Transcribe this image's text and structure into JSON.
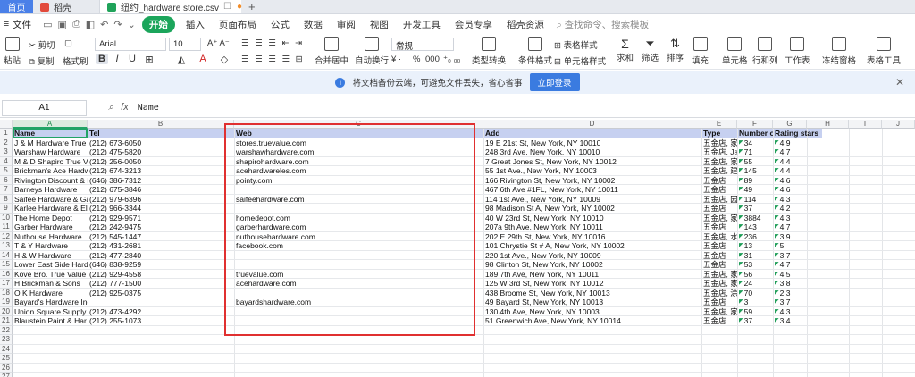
{
  "tabs": {
    "home": "首页",
    "shell": "稻壳",
    "doc": "纽约_hardware store.csv",
    "add": "+"
  },
  "menu": {
    "file": "文件",
    "items": [
      "开始",
      "插入",
      "页面布局",
      "公式",
      "数据",
      "审阅",
      "视图",
      "开发工具",
      "会员专享",
      "稻壳资源"
    ],
    "search": "查找命令、搜索模板"
  },
  "ribbon": {
    "paste": "粘贴",
    "cut": "剪切",
    "copy": "复制",
    "format_painter": "格式刷",
    "font": "Arial",
    "size": "10",
    "merge": "合并居中",
    "wrap": "自动换行",
    "numfmt": "常规",
    "type_convert": "类型转换",
    "cond_format": "条件格式",
    "table_style": "表格样式",
    "cell_style": "单元格样式",
    "sum": "求和",
    "filter": "筛选",
    "sort": "排序",
    "fill": "填充",
    "cell": "单元格",
    "rowcol": "行和列",
    "sheet": "工作表",
    "freeze": "冻结窗格",
    "table_tools": "表格工具",
    "percent": "%",
    "thousands": "000"
  },
  "notice": {
    "text": "将文档备份云端，可避免文件丢失，省心省事",
    "button": "立即登录"
  },
  "formula_bar": {
    "cell_ref": "A1",
    "fx": "fx",
    "value": "Name"
  },
  "columns": [
    "A",
    "B",
    "C",
    "D",
    "E",
    "F",
    "G",
    "H",
    "I",
    "J"
  ],
  "header_row": [
    "Name",
    "Tel",
    "Web",
    "Add",
    "Type",
    "Number o",
    "Rating stars"
  ],
  "rows": [
    [
      "J & M Hardware True V",
      "(212) 673-6050",
      "stores.truevalue.com",
      "19 E 21st St, New York, NY 10010",
      "五金店, 家",
      "34",
      "4.9"
    ],
    [
      "Warshaw Hardware",
      "(212) 475-5820",
      "warshawhardware.com",
      "248 3rd Ave, New York, NY 10010",
      "五金店, Ja",
      "71",
      "4.7"
    ],
    [
      "M & D Shapiro True V",
      "(212) 256-0050",
      "shapirohardware.com",
      "7 Great Jones St, New York, NY 10012",
      "五金店, 家",
      "55",
      "4.4"
    ],
    [
      "Brickman's Ace Hardw",
      "(212) 674-3213",
      "acehardwareles.com",
      "55 1st Ave., New York, NY 10003",
      "五金店, 建",
      "145",
      "4.4"
    ],
    [
      "Rivington Discount & H",
      "(646) 386-7312",
      "pointy.com",
      "166 Rivington St, New York, NY 10002",
      "五金店",
      "89",
      "4.6"
    ],
    [
      "Barneys Hardware",
      "(212) 675-3846",
      "",
      "467 6th Ave #1FL, New York, NY 10011",
      "五金店",
      "49",
      "4.6"
    ],
    [
      "Saifee Hardware & Ga",
      "(212) 979-6396",
      "saifeehardware.com",
      "114 1st Ave., New York, NY 10009",
      "五金店, 园",
      "114",
      "4.3"
    ],
    [
      "Karlee Hardware & Ele",
      "(212) 966-3344",
      "",
      "98 Madison St A, New York, NY 10002",
      "五金店",
      "37",
      "4.2"
    ],
    [
      "The Home Depot",
      "(212) 929-9571",
      "homedepot.com",
      "40 W 23rd St, New York, NY 10010",
      "五金店, 家",
      "3884",
      "4.3"
    ],
    [
      "Garber Hardware",
      "(212) 242-9475",
      "garberhardware.com",
      "207a 9th Ave, New York, NY 10011",
      "五金店",
      "143",
      "4.7"
    ],
    [
      "Nuthouse Hardware",
      "(212) 545-1447",
      "nuthousehardware.com",
      "202 E 29th St, New York, NY 10016",
      "五金店, 水",
      "236",
      "3.9"
    ],
    [
      "T & Y Hardware",
      "(212) 431-2681",
      "facebook.com",
      "101 Chrystie St # A, New York, NY 10002",
      "五金店",
      "13",
      "5"
    ],
    [
      "H & W Hardware",
      "(212) 477-2840",
      "",
      "220 1st Ave., New York, NY 10009",
      "五金店",
      "31",
      "3.7"
    ],
    [
      "Lower East Side Hardv",
      "(646) 838-9259",
      "",
      "98 Clinton St, New York, NY 10002",
      "五金店",
      "53",
      "4.7"
    ],
    [
      "Kove Bro. True Value H",
      "(212) 929-4558",
      "truevalue.com",
      "189 7th Ave, New York, NY 10011",
      "五金店, 家",
      "56",
      "4.5"
    ],
    [
      "H Brickman & Sons",
      "(212) 777-1500",
      "acehardware.com",
      "125 W 3rd St, New York, NY 10012",
      "五金店, 家",
      "24",
      "3.8"
    ],
    [
      "O K Hardware",
      "(212) 925-0375",
      "",
      "438 Broome St, New York, NY 10013",
      "五金店, 涂",
      "70",
      "2.3"
    ],
    [
      "Bayard's Hardware Inc.",
      "",
      "bayardshardware.com",
      "49 Bayard St, New York, NY 10013",
      "五金店",
      "3",
      "3.7"
    ],
    [
      "Union Square Supply",
      "(212) 473-4292",
      "",
      "130 4th Ave, New York, NY 10003",
      "五金店, 家",
      "59",
      "4.3"
    ],
    [
      "Blaustein Paint & Har",
      "(212) 255-1073",
      "",
      "51 Greenwich Ave, New York, NY 10014",
      "五金店",
      "37",
      "3.4"
    ]
  ],
  "row_numbers": [
    "1",
    "2",
    "3",
    "4",
    "5",
    "6",
    "7",
    "8",
    "9",
    "10",
    "11",
    "12",
    "13",
    "14",
    "15",
    "16",
    "17",
    "18",
    "19",
    "20",
    "21",
    "22",
    "23",
    "24",
    "25",
    "26",
    "27"
  ]
}
